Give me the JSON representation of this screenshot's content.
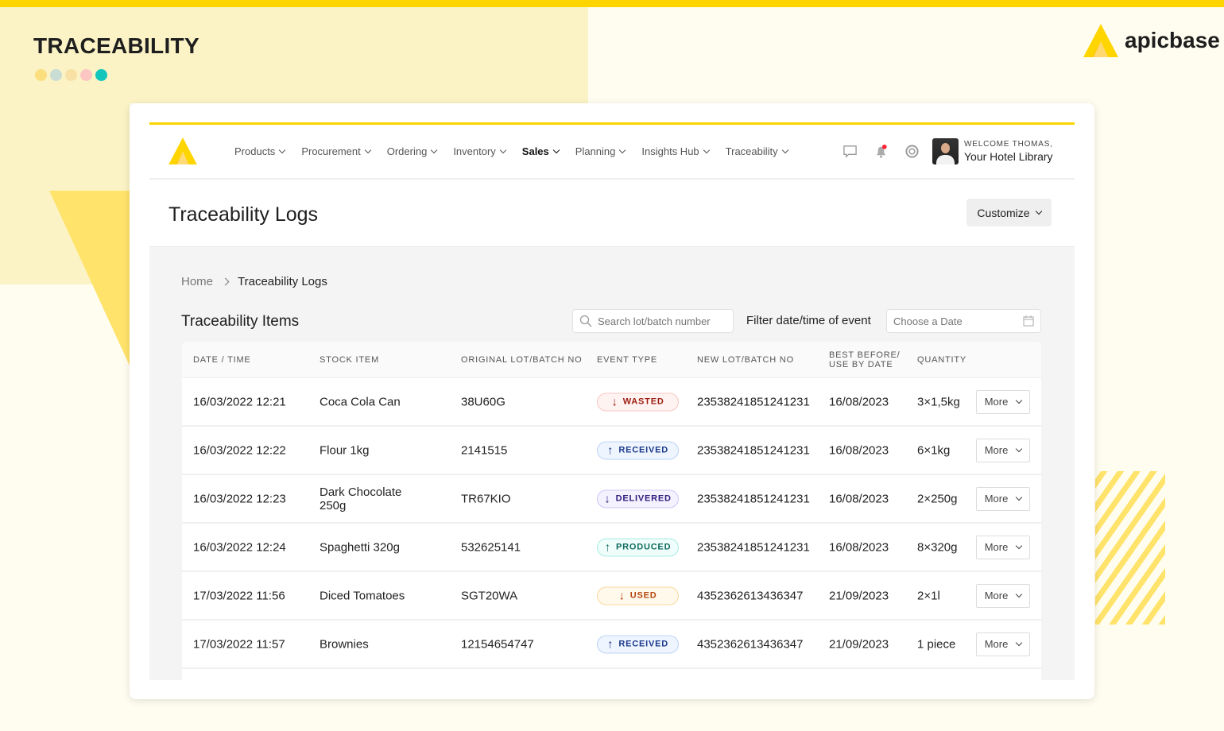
{
  "hero": {
    "title": "TRACEABILITY",
    "dots": [
      "#FBDF7E",
      "#CADDD5",
      "#F9E1A6",
      "#FCC6C3",
      "#12C6BC"
    ]
  },
  "brand": {
    "name": "apicbase",
    "accent": "#FFD500"
  },
  "nav": {
    "items": [
      {
        "label": "Products"
      },
      {
        "label": "Procurement"
      },
      {
        "label": "Ordering"
      },
      {
        "label": "Inventory"
      },
      {
        "label": "Sales",
        "active": true
      },
      {
        "label": "Planning"
      },
      {
        "label": "Insights Hub"
      },
      {
        "label": "Traceability"
      }
    ],
    "icons": [
      "chat-icon",
      "bell-icon",
      "help-icon"
    ],
    "user": {
      "welcome": "WELCOME THOMAS,",
      "library": "Your Hotel Library"
    }
  },
  "page": {
    "title": "Traceability Logs",
    "customize": "Customize"
  },
  "breadcrumb": {
    "home": "Home",
    "current": "Traceability Logs"
  },
  "section": {
    "title": "Traceability Items",
    "search_placeholder": "Search lot/batch number",
    "filter_label": "Filter date/time of event",
    "date_placeholder": "Choose a Date"
  },
  "table": {
    "headers": [
      "DATE / TIME",
      "STOCK ITEM",
      "ORIGINAL LOT/BATCH NO",
      "EVENT TYPE",
      "NEW LOT/BATCH NO",
      "BEST BEFORE/ USE BY DATE",
      "QUANTITY"
    ],
    "more_label": "More",
    "rows": [
      {
        "date": "16/03/2022 12:21",
        "item": "Coca Cola Can",
        "orig": "38U60G",
        "event": "WASTED",
        "dir": "down",
        "new": "23538241851241231",
        "best": "16/08/2023",
        "qty": "3×1,5kg"
      },
      {
        "date": "16/03/2022 12:22",
        "item": "Flour 1kg",
        "orig": "2141515",
        "event": "RECEIVED",
        "dir": "up",
        "new": "23538241851241231",
        "best": "16/08/2023",
        "qty": "6×1kg"
      },
      {
        "date": "16/03/2022 12:23",
        "item": "Dark Chocolate 250g",
        "orig": "TR67KIO",
        "event": "DELIVERED",
        "dir": "down",
        "new": "23538241851241231",
        "best": "16/08/2023",
        "qty": "2×250g"
      },
      {
        "date": "16/03/2022 12:24",
        "item": "Spaghetti 320g",
        "orig": "532625141",
        "event": "PRODUCED",
        "dir": "up",
        "new": "23538241851241231",
        "best": "16/08/2023",
        "qty": "8×320g"
      },
      {
        "date": "17/03/2022 11:56",
        "item": "Diced Tomatoes",
        "orig": "SGT20WA",
        "event": "USED",
        "dir": "down",
        "new": "4352362613436347",
        "best": "21/09/2023",
        "qty": "2×1l"
      },
      {
        "date": "17/03/2022 11:57",
        "item": "Brownies",
        "orig": "12154654747",
        "event": "RECEIVED",
        "dir": "up",
        "new": "4352362613436347",
        "best": "21/09/2023",
        "qty": "1 piece"
      }
    ]
  },
  "badge_colors": {
    "WASTED": {
      "fg": "#9B1C0E",
      "bg": "#FFF3F2",
      "border": "#F8C6C0"
    },
    "RECEIVED": {
      "fg": "#1B3A8A",
      "bg": "#EFF5FF",
      "border": "#BCD3F5"
    },
    "DELIVERED": {
      "fg": "#2E1A7A",
      "bg": "#F5F2FF",
      "border": "#CFC5F5"
    },
    "PRODUCED": {
      "fg": "#0E6B5C",
      "bg": "#EFFDFB",
      "border": "#A8ECE2"
    },
    "USED": {
      "fg": "#B3460D",
      "bg": "#FFF9EC",
      "border": "#F8D79A"
    }
  }
}
